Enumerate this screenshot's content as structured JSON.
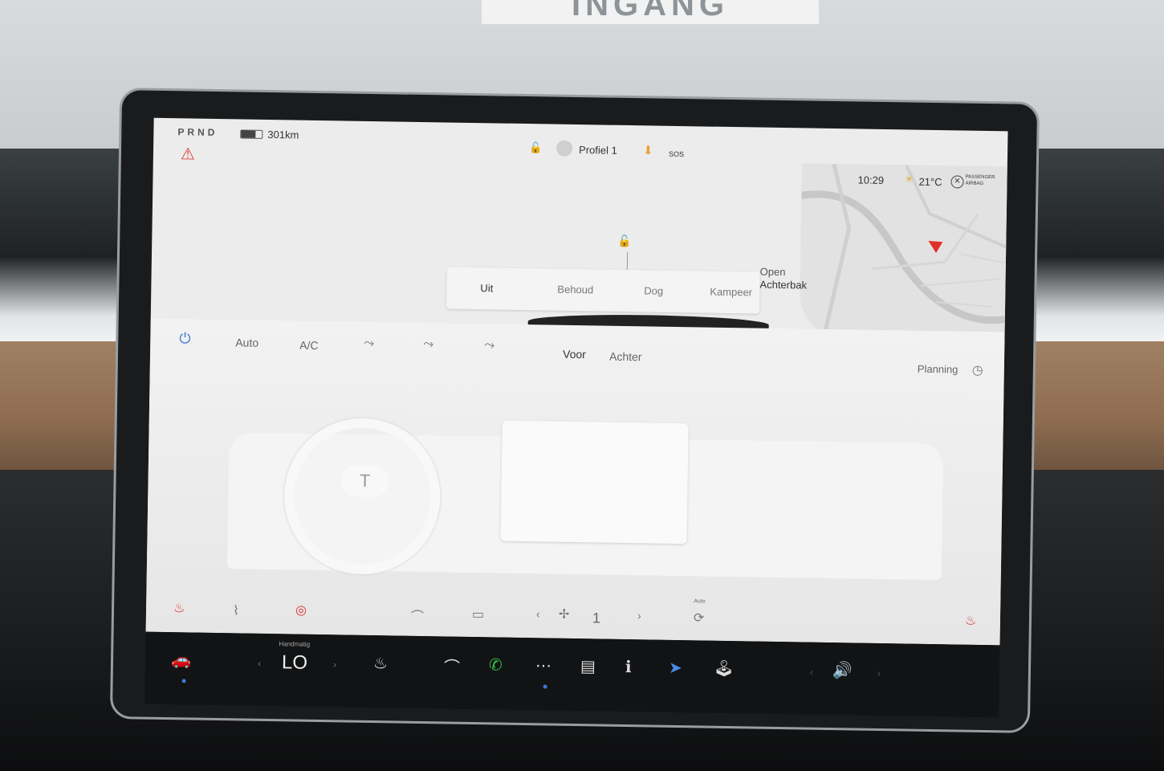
{
  "background": {
    "sign_text": "INGANG"
  },
  "status_bar": {
    "gear": "PRND",
    "range": "301km",
    "profile": "Profiel 1",
    "sos": "SOS",
    "time": "10:29",
    "temperature": "21°C",
    "airbag_line1": "PASSENGER",
    "airbag_line2": "AIRBAG"
  },
  "trunk": {
    "line1": "Open",
    "line2": "Achterbak"
  },
  "modes": [
    "Uit",
    "Behoud",
    "Dog",
    "Kampeer"
  ],
  "climate": {
    "auto": "Auto",
    "ac": "A/C",
    "front": "Voor",
    "rear": "Achter",
    "planning": "Planning",
    "fan_speed": "1",
    "recirc_label": "Auto"
  },
  "taskbar": {
    "temp_mode": "Handmatig",
    "temp_value": "LO"
  },
  "colors": {
    "accent": "#3a7bd5",
    "alert": "#d33333",
    "phone": "#2ec24a"
  }
}
